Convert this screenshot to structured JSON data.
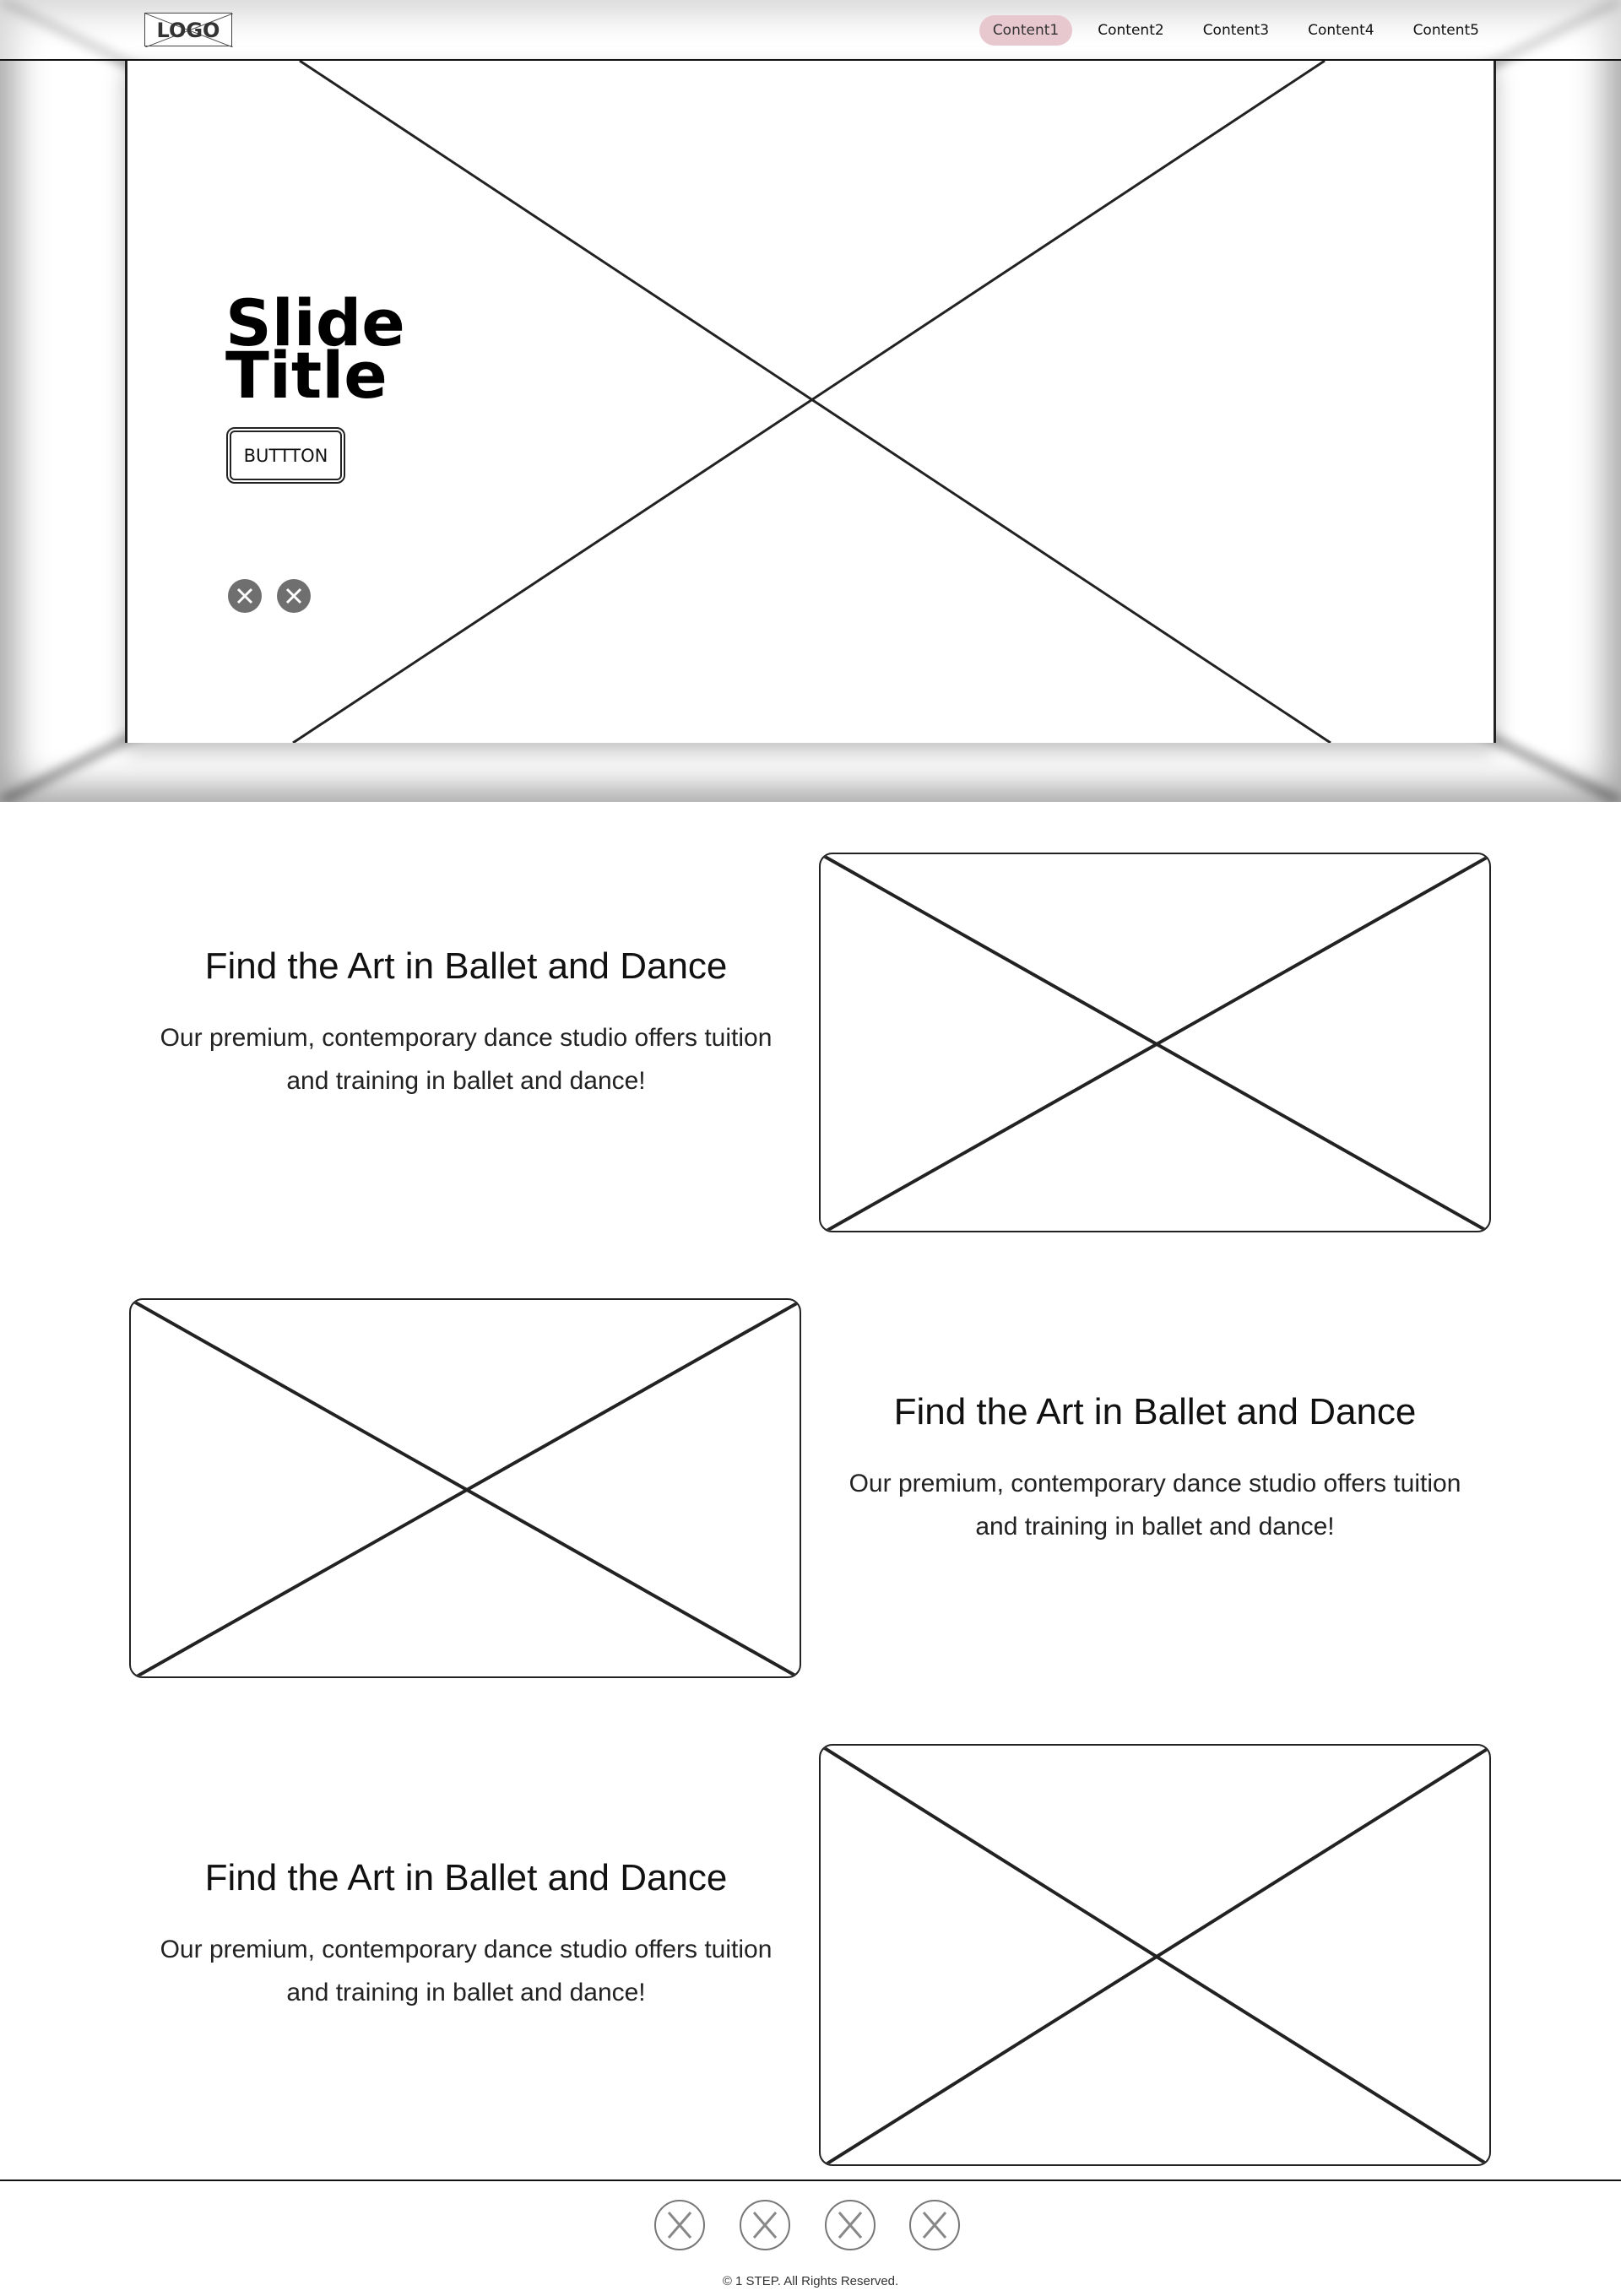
{
  "header": {
    "logo_text": "LOGO",
    "nav": [
      "Content1",
      "Content2",
      "Content3",
      "Content4",
      "Content5"
    ],
    "active_nav": "Content1",
    "active_color": "#e8c8cf"
  },
  "hero": {
    "title_line1": "Slide",
    "title_line2": "Title",
    "button_label": "BUTTTON",
    "dot_icon": "close-circle-icon"
  },
  "features": [
    {
      "title": "Find the Art in Ballet and Dance",
      "line1": "Our premium, contemporary dance studio offers tuition",
      "line2": "and training in ballet and dance!"
    },
    {
      "title": "Find the Art in Ballet and Dance",
      "line1": "Our premium, contemporary dance studio offers tuition",
      "line2": "and training in ballet and dance!"
    },
    {
      "title": "Find the Art in Ballet and Dance",
      "line1": "Our premium, contemporary dance studio offers tuition",
      "line2": "and training in ballet and dance!"
    }
  ],
  "footer": {
    "social_icons": [
      "social-icon-1",
      "social-icon-2",
      "social-icon-3",
      "social-icon-4"
    ],
    "copyright": "© 1 STEP. All Rights Reserved."
  }
}
